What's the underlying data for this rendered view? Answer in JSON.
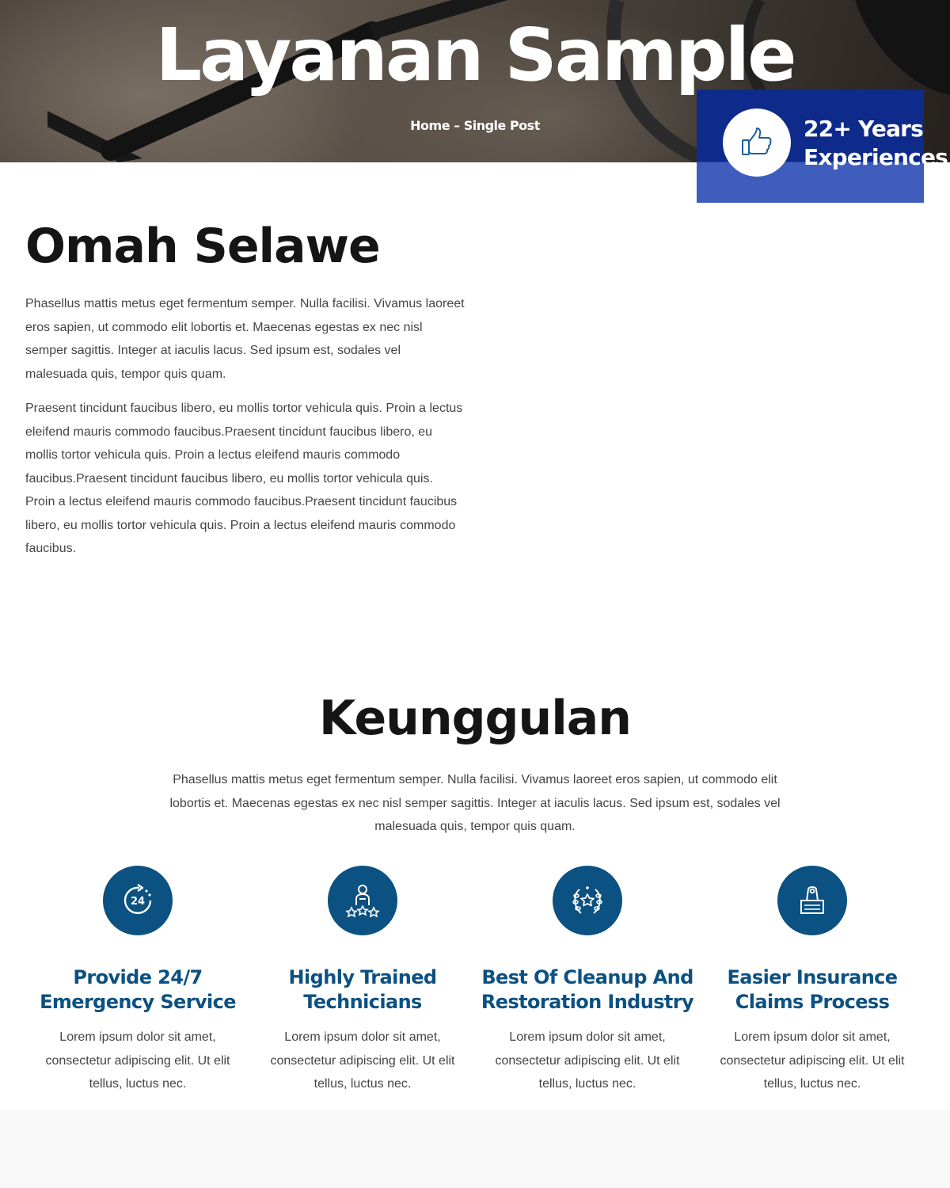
{
  "hero": {
    "title": "Layanan Sample",
    "breadcrumb": {
      "home": "Home",
      "separator": " – ",
      "current": "Single Post"
    }
  },
  "experience": {
    "icon": "thumbs-up-icon",
    "line1": "22+ Years",
    "line2": "Experiences"
  },
  "about": {
    "title": "Omah Selawe",
    "paragraphs": [
      "Phasellus mattis metus eget fermentum semper. Nulla facilisi. Vivamus laoreet eros sapien, ut commodo elit lobortis et. Maecenas egestas ex nec nisl semper sagittis. Integer at iaculis lacus. Sed ipsum est, sodales vel malesuada quis, tempor quis quam.",
      "Praesent tincidunt faucibus libero, eu mollis tortor vehicula quis. Proin a lectus eleifend mauris commodo faucibus.Praesent tincidunt faucibus libero, eu mollis tortor vehicula quis. Proin a lectus eleifend mauris commodo faucibus.Praesent tincidunt faucibus libero, eu mollis tortor vehicula quis. Proin a lectus eleifend mauris commodo faucibus.Praesent tincidunt faucibus libero, eu mollis tortor vehicula quis. Proin a lectus eleifend mauris commodo faucibus."
    ]
  },
  "features": {
    "title": "Keunggulan",
    "intro": "Phasellus mattis metus eget fermentum semper. Nulla facilisi. Vivamus laoreet eros sapien, ut commodo elit lobortis et. Maecenas egestas ex nec nisl semper sagittis. Integer at iaculis lacus. Sed ipsum est, sodales vel malesuada quis, tempor quis quam.",
    "items": [
      {
        "icon": "24-hours-icon",
        "title": "Provide 24/7 Emergency Service",
        "text": "Lorem ipsum dolor sit amet, consectetur adipiscing elit. Ut elit tellus, luctus nec."
      },
      {
        "icon": "technician-rating-icon",
        "title": "Highly Trained Technicians",
        "text": "Lorem ipsum dolor sit amet, consectetur adipiscing elit. Ut elit tellus, luctus nec."
      },
      {
        "icon": "laurel-star-icon",
        "title": "Best Of Cleanup And Restoration Industry",
        "text": "Lorem ipsum dolor sit amet, consectetur adipiscing elit. Ut elit tellus, luctus nec."
      },
      {
        "icon": "binder-clip-icon",
        "title": "Easier Insurance Claims Process",
        "text": "Lorem ipsum dolor sit amet, consectetur adipiscing elit. Ut elit tellus, luctus nec."
      }
    ]
  },
  "colors": {
    "accent": "#0b5181",
    "badge_dark": "#0e2a8a",
    "badge_light": "#3e5dbd",
    "heading": "#151515"
  }
}
